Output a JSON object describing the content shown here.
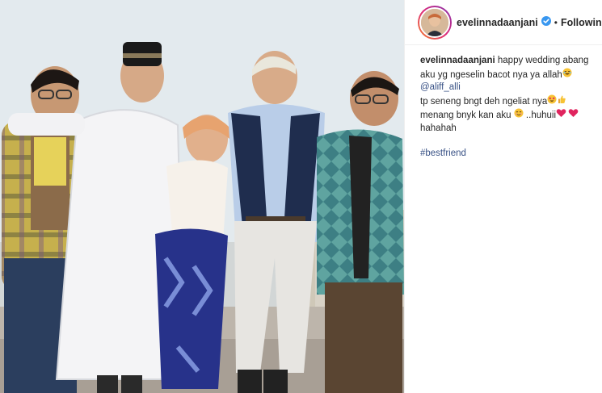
{
  "post": {
    "photo_alt": "Group photo"
  },
  "header": {
    "username": "evelinnadaanjani",
    "separator": "•",
    "follow_state": "Following"
  },
  "caption": {
    "author": "evelinnadaanjani",
    "line1_text": "happy wedding abang",
    "line2_text": "aku yg ngeselin bacot nya ya allah",
    "mention": "@aliff_alli",
    "line4_text": "tp seneng bngt deh ngeliat nya",
    "line5_text": "menang bnyk kan aku",
    "line5_tail": " ..huhuii",
    "line6_text": "hahahah",
    "hashtag": "#bestfriend"
  },
  "icons": {
    "verified": "verified-badge-icon",
    "laugh": "laughing-emoji-icon",
    "star_eyes": "star-struck-emoji-icon",
    "thumbs_up": "thumbs-up-emoji-icon",
    "smile": "smiling-emoji-icon",
    "heart": "red-heart-emoji-icon"
  },
  "colors": {
    "verified_blue": "#3897f0",
    "link_blue": "#385185",
    "heart_red": "#e0245e",
    "emoji_yellow": "#f7c234"
  }
}
